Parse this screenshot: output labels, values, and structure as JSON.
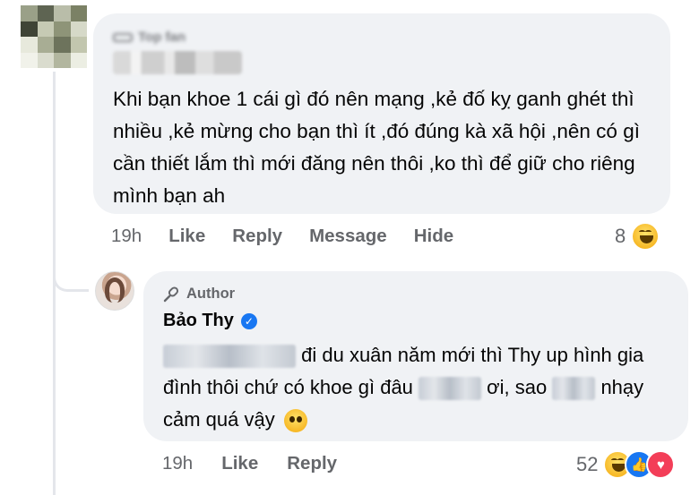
{
  "comment1": {
    "badge": "Top fan",
    "text": "Khi bạn khoe 1 cái gì đó nên mạng ,kẻ đố kỵ ganh ghét thì nhiều ,kẻ mừng cho bạn thì ít ,đó đúng kà xã hội ,nên có gì cần thiết lắm thì mới đăng nên thôi ,ko thì để giữ cho riêng mình bạn ah",
    "time": "19h",
    "like": "Like",
    "reply": "Reply",
    "message": "Message",
    "hide": "Hide",
    "reaction_count": "8",
    "reactions": [
      "haha-icon"
    ]
  },
  "reply": {
    "badge": "Author",
    "author": "Bảo Thy",
    "text_part1": "đi du xuân năm mới thì Thy up hình gia đình thôi chứ có khoe gì đâu",
    "text_part2": "ơi, sao",
    "text_part3": "nhạy cảm quá vậy",
    "time": "19h",
    "like": "Like",
    "reply": "Reply",
    "reaction_count": "52",
    "reactions": [
      "haha-icon",
      "like-icon",
      "love-icon"
    ]
  },
  "colors": {
    "bubble": "#f0f2f5",
    "meta": "#65676b",
    "text": "#050505",
    "verified": "#1877f2",
    "love": "#f33e58"
  }
}
